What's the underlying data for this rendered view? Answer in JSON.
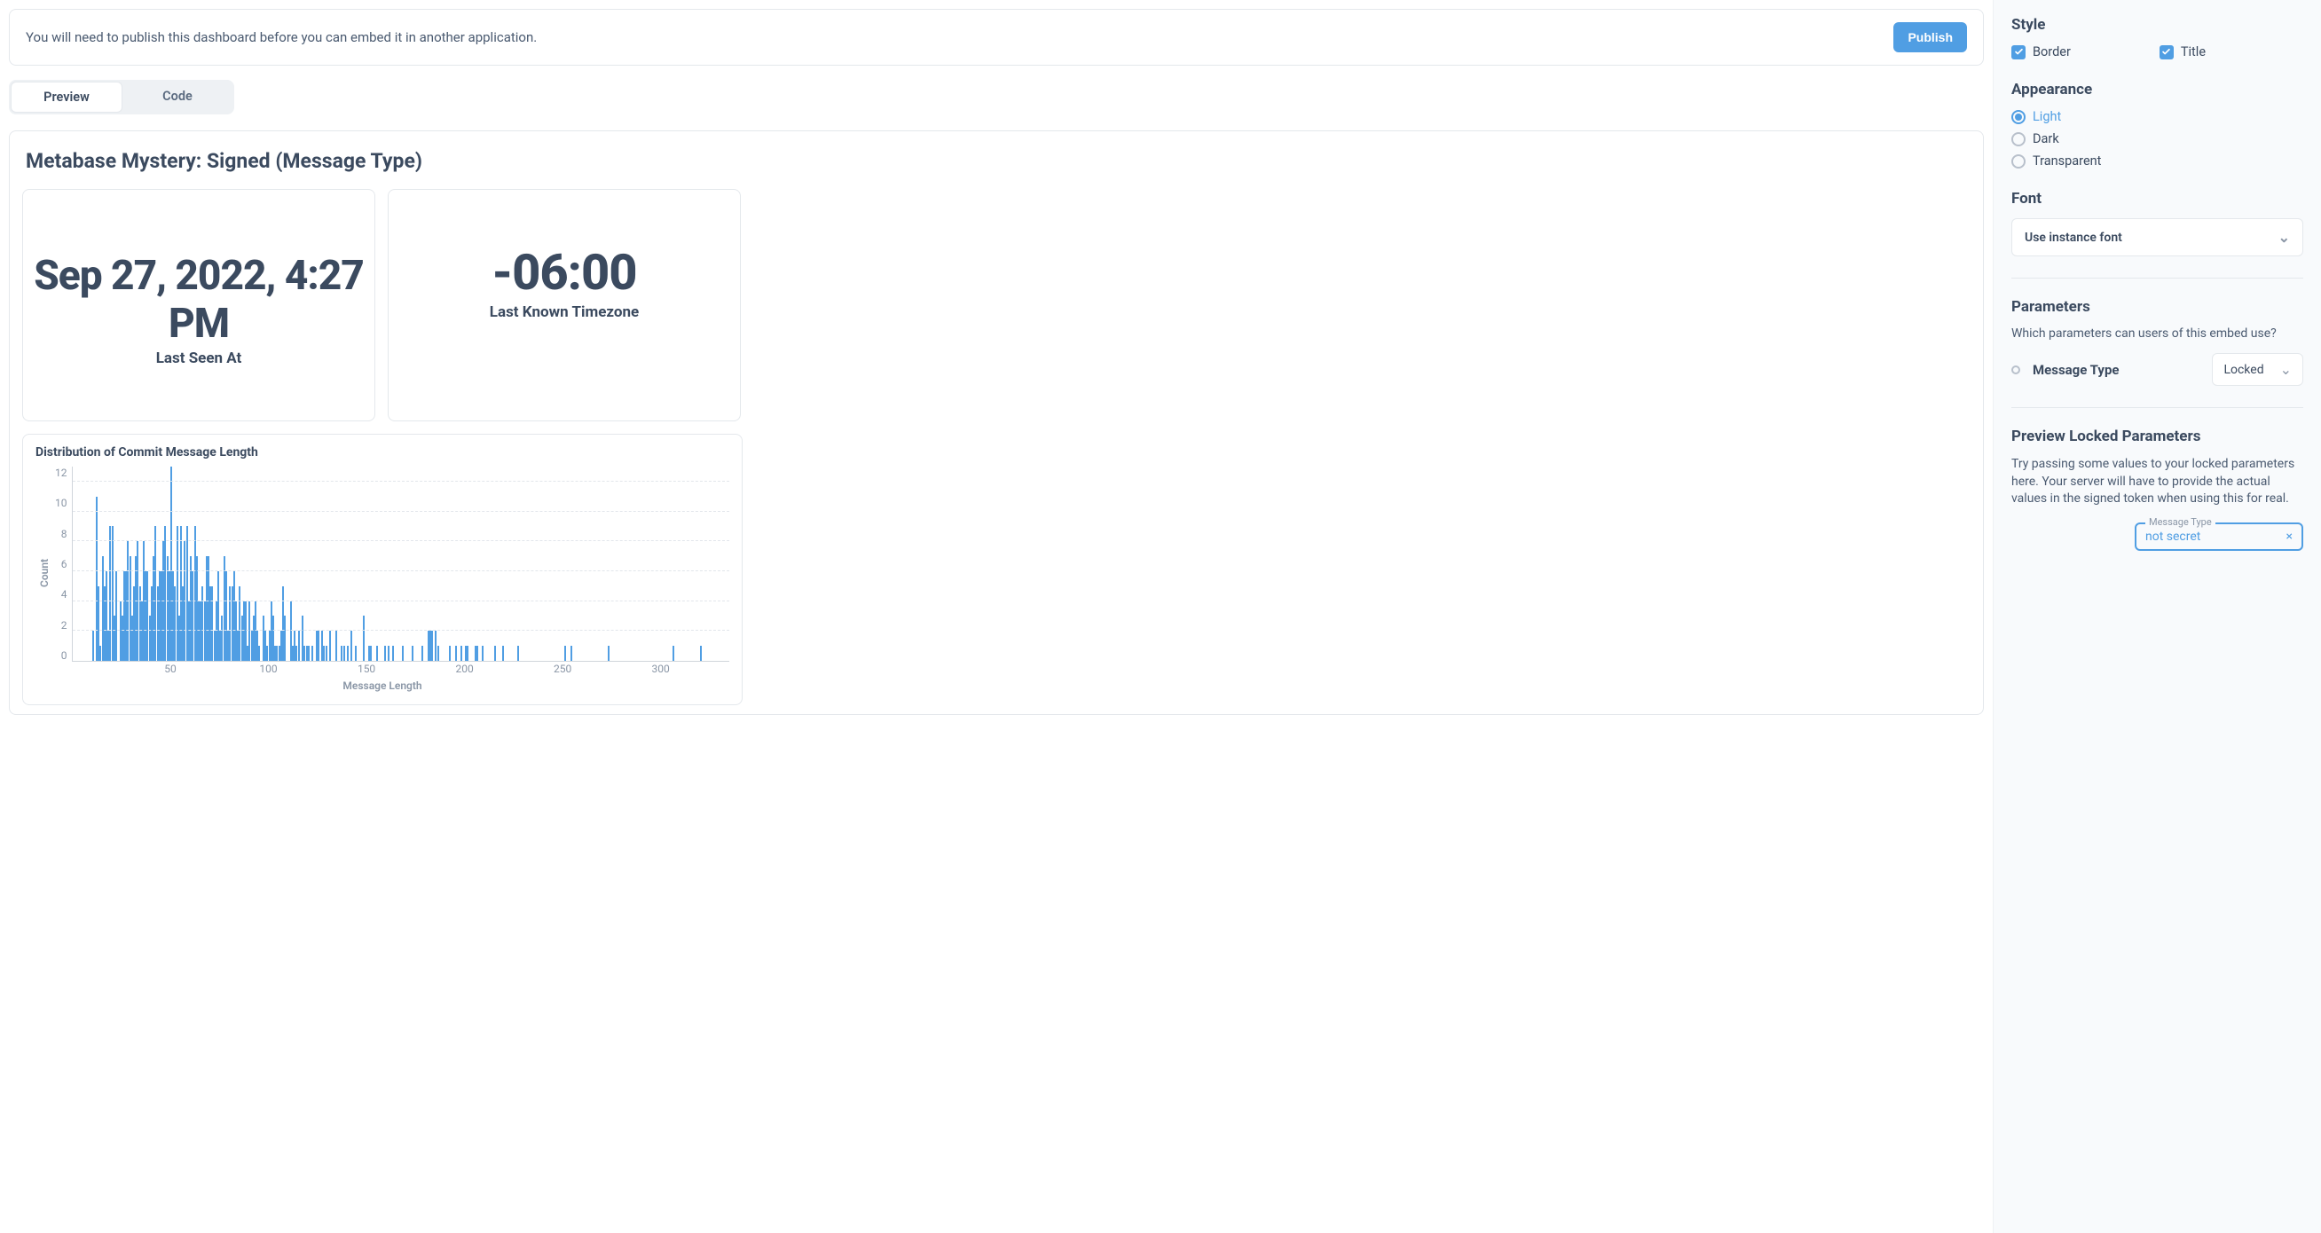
{
  "banner": {
    "text": "You will need to publish this dashboard before you can embed it in another application.",
    "publish_label": "Publish"
  },
  "tabs": {
    "preview": "Preview",
    "code": "Code",
    "active": "preview"
  },
  "dashboard": {
    "title": "Metabase Mystery: Signed (Message Type)",
    "cards": {
      "last_seen": {
        "value": "Sep 27, 2022, 4:27 PM",
        "label": "Last Seen At"
      },
      "timezone": {
        "value": "-06:00",
        "label": "Last Known Timezone"
      }
    }
  },
  "chart_data": {
    "type": "bar",
    "title": "Distribution of Commit Message Length",
    "xlabel": "Message Length",
    "ylabel": "Count",
    "ylim": [
      0,
      13
    ],
    "xlim": [
      0,
      335
    ],
    "y_ticks": [
      12,
      10,
      8,
      6,
      4,
      2,
      0
    ],
    "x_ticks": [
      50,
      100,
      150,
      200,
      250,
      300
    ],
    "series": [
      {
        "name": "Count",
        "values": [
          {
            "x": 10,
            "y": 2
          },
          {
            "x": 12,
            "y": 11
          },
          {
            "x": 13,
            "y": 5
          },
          {
            "x": 14,
            "y": 1
          },
          {
            "x": 15,
            "y": 7
          },
          {
            "x": 16,
            "y": 5
          },
          {
            "x": 17,
            "y": 6
          },
          {
            "x": 18,
            "y": 2
          },
          {
            "x": 19,
            "y": 9
          },
          {
            "x": 20,
            "y": 9
          },
          {
            "x": 21,
            "y": 3
          },
          {
            "x": 22,
            "y": 6
          },
          {
            "x": 24,
            "y": 4
          },
          {
            "x": 25,
            "y": 3
          },
          {
            "x": 26,
            "y": 6
          },
          {
            "x": 27,
            "y": 6
          },
          {
            "x": 28,
            "y": 8
          },
          {
            "x": 29,
            "y": 7
          },
          {
            "x": 30,
            "y": 3
          },
          {
            "x": 31,
            "y": 5
          },
          {
            "x": 32,
            "y": 7
          },
          {
            "x": 33,
            "y": 8
          },
          {
            "x": 34,
            "y": 5
          },
          {
            "x": 35,
            "y": 4
          },
          {
            "x": 36,
            "y": 8
          },
          {
            "x": 37,
            "y": 6
          },
          {
            "x": 38,
            "y": 6
          },
          {
            "x": 39,
            "y": 3
          },
          {
            "x": 40,
            "y": 5
          },
          {
            "x": 41,
            "y": 7
          },
          {
            "x": 42,
            "y": 9
          },
          {
            "x": 43,
            "y": 5
          },
          {
            "x": 44,
            "y": 6
          },
          {
            "x": 45,
            "y": 6
          },
          {
            "x": 46,
            "y": 8
          },
          {
            "x": 47,
            "y": 9
          },
          {
            "x": 48,
            "y": 7
          },
          {
            "x": 49,
            "y": 6
          },
          {
            "x": 50,
            "y": 13
          },
          {
            "x": 51,
            "y": 6
          },
          {
            "x": 52,
            "y": 5
          },
          {
            "x": 53,
            "y": 9
          },
          {
            "x": 54,
            "y": 3
          },
          {
            "x": 55,
            "y": 9
          },
          {
            "x": 56,
            "y": 5
          },
          {
            "x": 57,
            "y": 8
          },
          {
            "x": 58,
            "y": 9
          },
          {
            "x": 59,
            "y": 4
          },
          {
            "x": 60,
            "y": 7
          },
          {
            "x": 61,
            "y": 6
          },
          {
            "x": 62,
            "y": 9
          },
          {
            "x": 63,
            "y": 7
          },
          {
            "x": 64,
            "y": 4
          },
          {
            "x": 65,
            "y": 4
          },
          {
            "x": 66,
            "y": 5
          },
          {
            "x": 67,
            "y": 4
          },
          {
            "x": 68,
            "y": 7
          },
          {
            "x": 69,
            "y": 7
          },
          {
            "x": 70,
            "y": 5
          },
          {
            "x": 71,
            "y": 5
          },
          {
            "x": 72,
            "y": 2
          },
          {
            "x": 73,
            "y": 4
          },
          {
            "x": 74,
            "y": 6
          },
          {
            "x": 75,
            "y": 2
          },
          {
            "x": 76,
            "y": 3
          },
          {
            "x": 77,
            "y": 7
          },
          {
            "x": 78,
            "y": 6
          },
          {
            "x": 79,
            "y": 2
          },
          {
            "x": 80,
            "y": 5
          },
          {
            "x": 81,
            "y": 5
          },
          {
            "x": 82,
            "y": 6
          },
          {
            "x": 83,
            "y": 4
          },
          {
            "x": 84,
            "y": 2
          },
          {
            "x": 85,
            "y": 5
          },
          {
            "x": 86,
            "y": 3
          },
          {
            "x": 87,
            "y": 4
          },
          {
            "x": 88,
            "y": 4
          },
          {
            "x": 89,
            "y": 1
          },
          {
            "x": 90,
            "y": 4
          },
          {
            "x": 91,
            "y": 2
          },
          {
            "x": 92,
            "y": 3
          },
          {
            "x": 93,
            "y": 4
          },
          {
            "x": 94,
            "y": 2
          },
          {
            "x": 95,
            "y": 1
          },
          {
            "x": 97,
            "y": 3
          },
          {
            "x": 98,
            "y": 2
          },
          {
            "x": 99,
            "y": 1
          },
          {
            "x": 100,
            "y": 2
          },
          {
            "x": 101,
            "y": 4
          },
          {
            "x": 102,
            "y": 3
          },
          {
            "x": 103,
            "y": 1
          },
          {
            "x": 104,
            "y": 1
          },
          {
            "x": 105,
            "y": 1
          },
          {
            "x": 106,
            "y": 2
          },
          {
            "x": 107,
            "y": 5
          },
          {
            "x": 108,
            "y": 3
          },
          {
            "x": 111,
            "y": 4
          },
          {
            "x": 112,
            "y": 1
          },
          {
            "x": 113,
            "y": 2
          },
          {
            "x": 114,
            "y": 1
          },
          {
            "x": 115,
            "y": 2
          },
          {
            "x": 117,
            "y": 3
          },
          {
            "x": 118,
            "y": 1
          },
          {
            "x": 119,
            "y": 1
          },
          {
            "x": 120,
            "y": 1
          },
          {
            "x": 122,
            "y": 1
          },
          {
            "x": 124,
            "y": 2
          },
          {
            "x": 125,
            "y": 2
          },
          {
            "x": 127,
            "y": 2
          },
          {
            "x": 128,
            "y": 1
          },
          {
            "x": 129,
            "y": 1
          },
          {
            "x": 131,
            "y": 2
          },
          {
            "x": 134,
            "y": 2
          },
          {
            "x": 137,
            "y": 1
          },
          {
            "x": 138,
            "y": 1
          },
          {
            "x": 140,
            "y": 1
          },
          {
            "x": 142,
            "y": 2
          },
          {
            "x": 144,
            "y": 1
          },
          {
            "x": 148,
            "y": 3
          },
          {
            "x": 151,
            "y": 1
          },
          {
            "x": 152,
            "y": 1
          },
          {
            "x": 155,
            "y": 1
          },
          {
            "x": 159,
            "y": 1
          },
          {
            "x": 161,
            "y": 1
          },
          {
            "x": 163,
            "y": 1
          },
          {
            "x": 168,
            "y": 1
          },
          {
            "x": 173,
            "y": 1
          },
          {
            "x": 178,
            "y": 1
          },
          {
            "x": 181,
            "y": 2
          },
          {
            "x": 182,
            "y": 2
          },
          {
            "x": 183,
            "y": 2
          },
          {
            "x": 185,
            "y": 2
          },
          {
            "x": 186,
            "y": 1
          },
          {
            "x": 192,
            "y": 1
          },
          {
            "x": 195,
            "y": 1
          },
          {
            "x": 198,
            "y": 1
          },
          {
            "x": 200,
            "y": 1
          },
          {
            "x": 201,
            "y": 1
          },
          {
            "x": 205,
            "y": 1
          },
          {
            "x": 206,
            "y": 1
          },
          {
            "x": 209,
            "y": 1
          },
          {
            "x": 215,
            "y": 1
          },
          {
            "x": 219,
            "y": 1
          },
          {
            "x": 227,
            "y": 1
          },
          {
            "x": 251,
            "y": 1
          },
          {
            "x": 254,
            "y": 1
          },
          {
            "x": 273,
            "y": 1
          },
          {
            "x": 306,
            "y": 1
          },
          {
            "x": 320,
            "y": 1
          }
        ]
      }
    ]
  },
  "sidebar": {
    "style": {
      "title": "Style",
      "border": "Border",
      "title_cb": "Title"
    },
    "appearance": {
      "title": "Appearance",
      "light": "Light",
      "dark": "Dark",
      "transparent": "Transparent",
      "selected": "light"
    },
    "font": {
      "title": "Font",
      "selected": "Use instance font"
    },
    "parameters": {
      "title": "Parameters",
      "desc": "Which parameters can users of this embed use?",
      "param_name": "Message Type",
      "param_state": "Locked"
    },
    "preview_locked": {
      "title": "Preview Locked Parameters",
      "desc": "Try passing some values to your locked parameters here. Your server will have to provide the actual values in the signed token when using this for real.",
      "input_label": "Message Type",
      "input_value": "not secret"
    }
  }
}
